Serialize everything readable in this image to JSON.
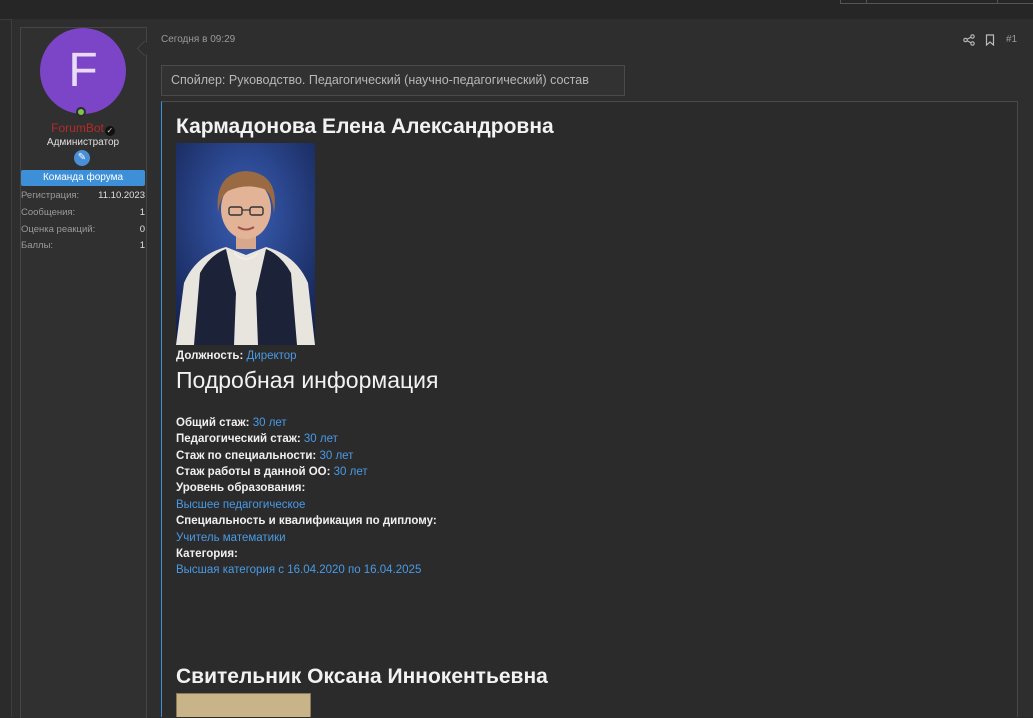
{
  "user": {
    "avatar_letter": "F",
    "username": "ForumBot",
    "role": "Администратор",
    "badge": "Команда форума",
    "stats": [
      {
        "label": "Регистрация:",
        "value": "11.10.2023"
      },
      {
        "label": "Сообщения:",
        "value": "1"
      },
      {
        "label": "Оценка реакций:",
        "value": "0"
      },
      {
        "label": "Баллы:",
        "value": "1"
      }
    ]
  },
  "post": {
    "date": "Сегодня в 09:29",
    "number": "#1",
    "spoiler_label": "Спойлер: Руководство. Педагогический (научно-педагогический) состав"
  },
  "people": [
    {
      "name": "Кармадонова Елена Александровна",
      "position_label": "Должность:",
      "position_value": "Директор",
      "details_heading": "Подробная информация",
      "fields": [
        {
          "label": "Общий стаж:",
          "value": "30 лет"
        },
        {
          "label": "Педагогический стаж:",
          "value": "30 лет"
        },
        {
          "label": "Стаж по специальности:",
          "value": "30 лет"
        },
        {
          "label": "Стаж работы в данной ОО:",
          "value": "30 лет"
        }
      ],
      "education_label": "Уровень образования:",
      "education_value": "Высшее педагогическое",
      "specialty_label": "Специальность и квалификация по диплому:",
      "specialty_value": "Учитель математики",
      "category_label": "Категория:",
      "category_value": "Высшая категория с 16.04.2020 по 16.04.2025"
    },
    {
      "name": "Свительник Оксана Иннокентьевна"
    }
  ],
  "colors": {
    "accent": "#3d8fd8",
    "link": "#4a9ae6",
    "avatar": "#7c44c7",
    "username": "#b52a2a",
    "online": "#7cc44a"
  }
}
